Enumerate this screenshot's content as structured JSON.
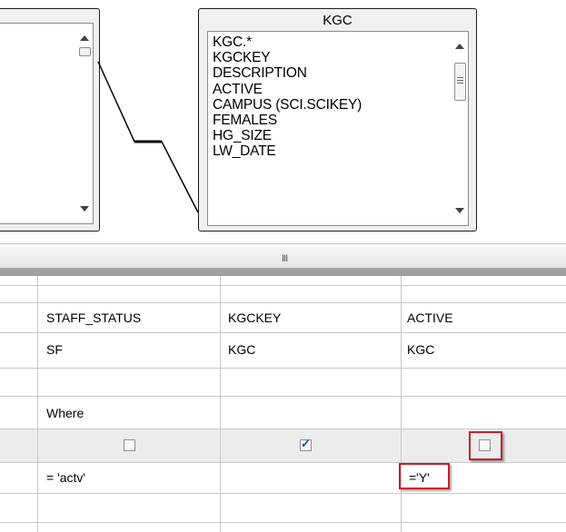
{
  "diagram": {
    "kgc_table": {
      "title": "KGC",
      "fields": [
        "KGC.*",
        "KGCKEY",
        "DESCRIPTION",
        "ACTIVE",
        "CAMPUS (SCI.SCIKEY)",
        "FEMALES",
        "HG_SIZE",
        "LW_DATE"
      ]
    }
  },
  "splitter": {
    "grip_glyph": "III"
  },
  "grid": {
    "columns": [
      {
        "column": "STAFF_STATUS",
        "table": "SF",
        "aggregate": "",
        "sort": "Where",
        "output": false,
        "criteria": "= 'actv'"
      },
      {
        "column": "KGCKEY",
        "table": "KGC",
        "aggregate": "",
        "sort": "",
        "output": true,
        "criteria": ""
      },
      {
        "column": "ACTIVE",
        "table": "KGC",
        "aggregate": "",
        "sort": "",
        "output": false,
        "criteria": "='Y'"
      }
    ]
  },
  "colors": {
    "highlight": "#c8202a",
    "check": "#1c4fa0",
    "splitbar": "#9f9f9f"
  },
  "icons": [
    "scroll-up-icon",
    "scroll-down-icon",
    "scroll-thumb-grip-icon",
    "checkmark-icon"
  ]
}
